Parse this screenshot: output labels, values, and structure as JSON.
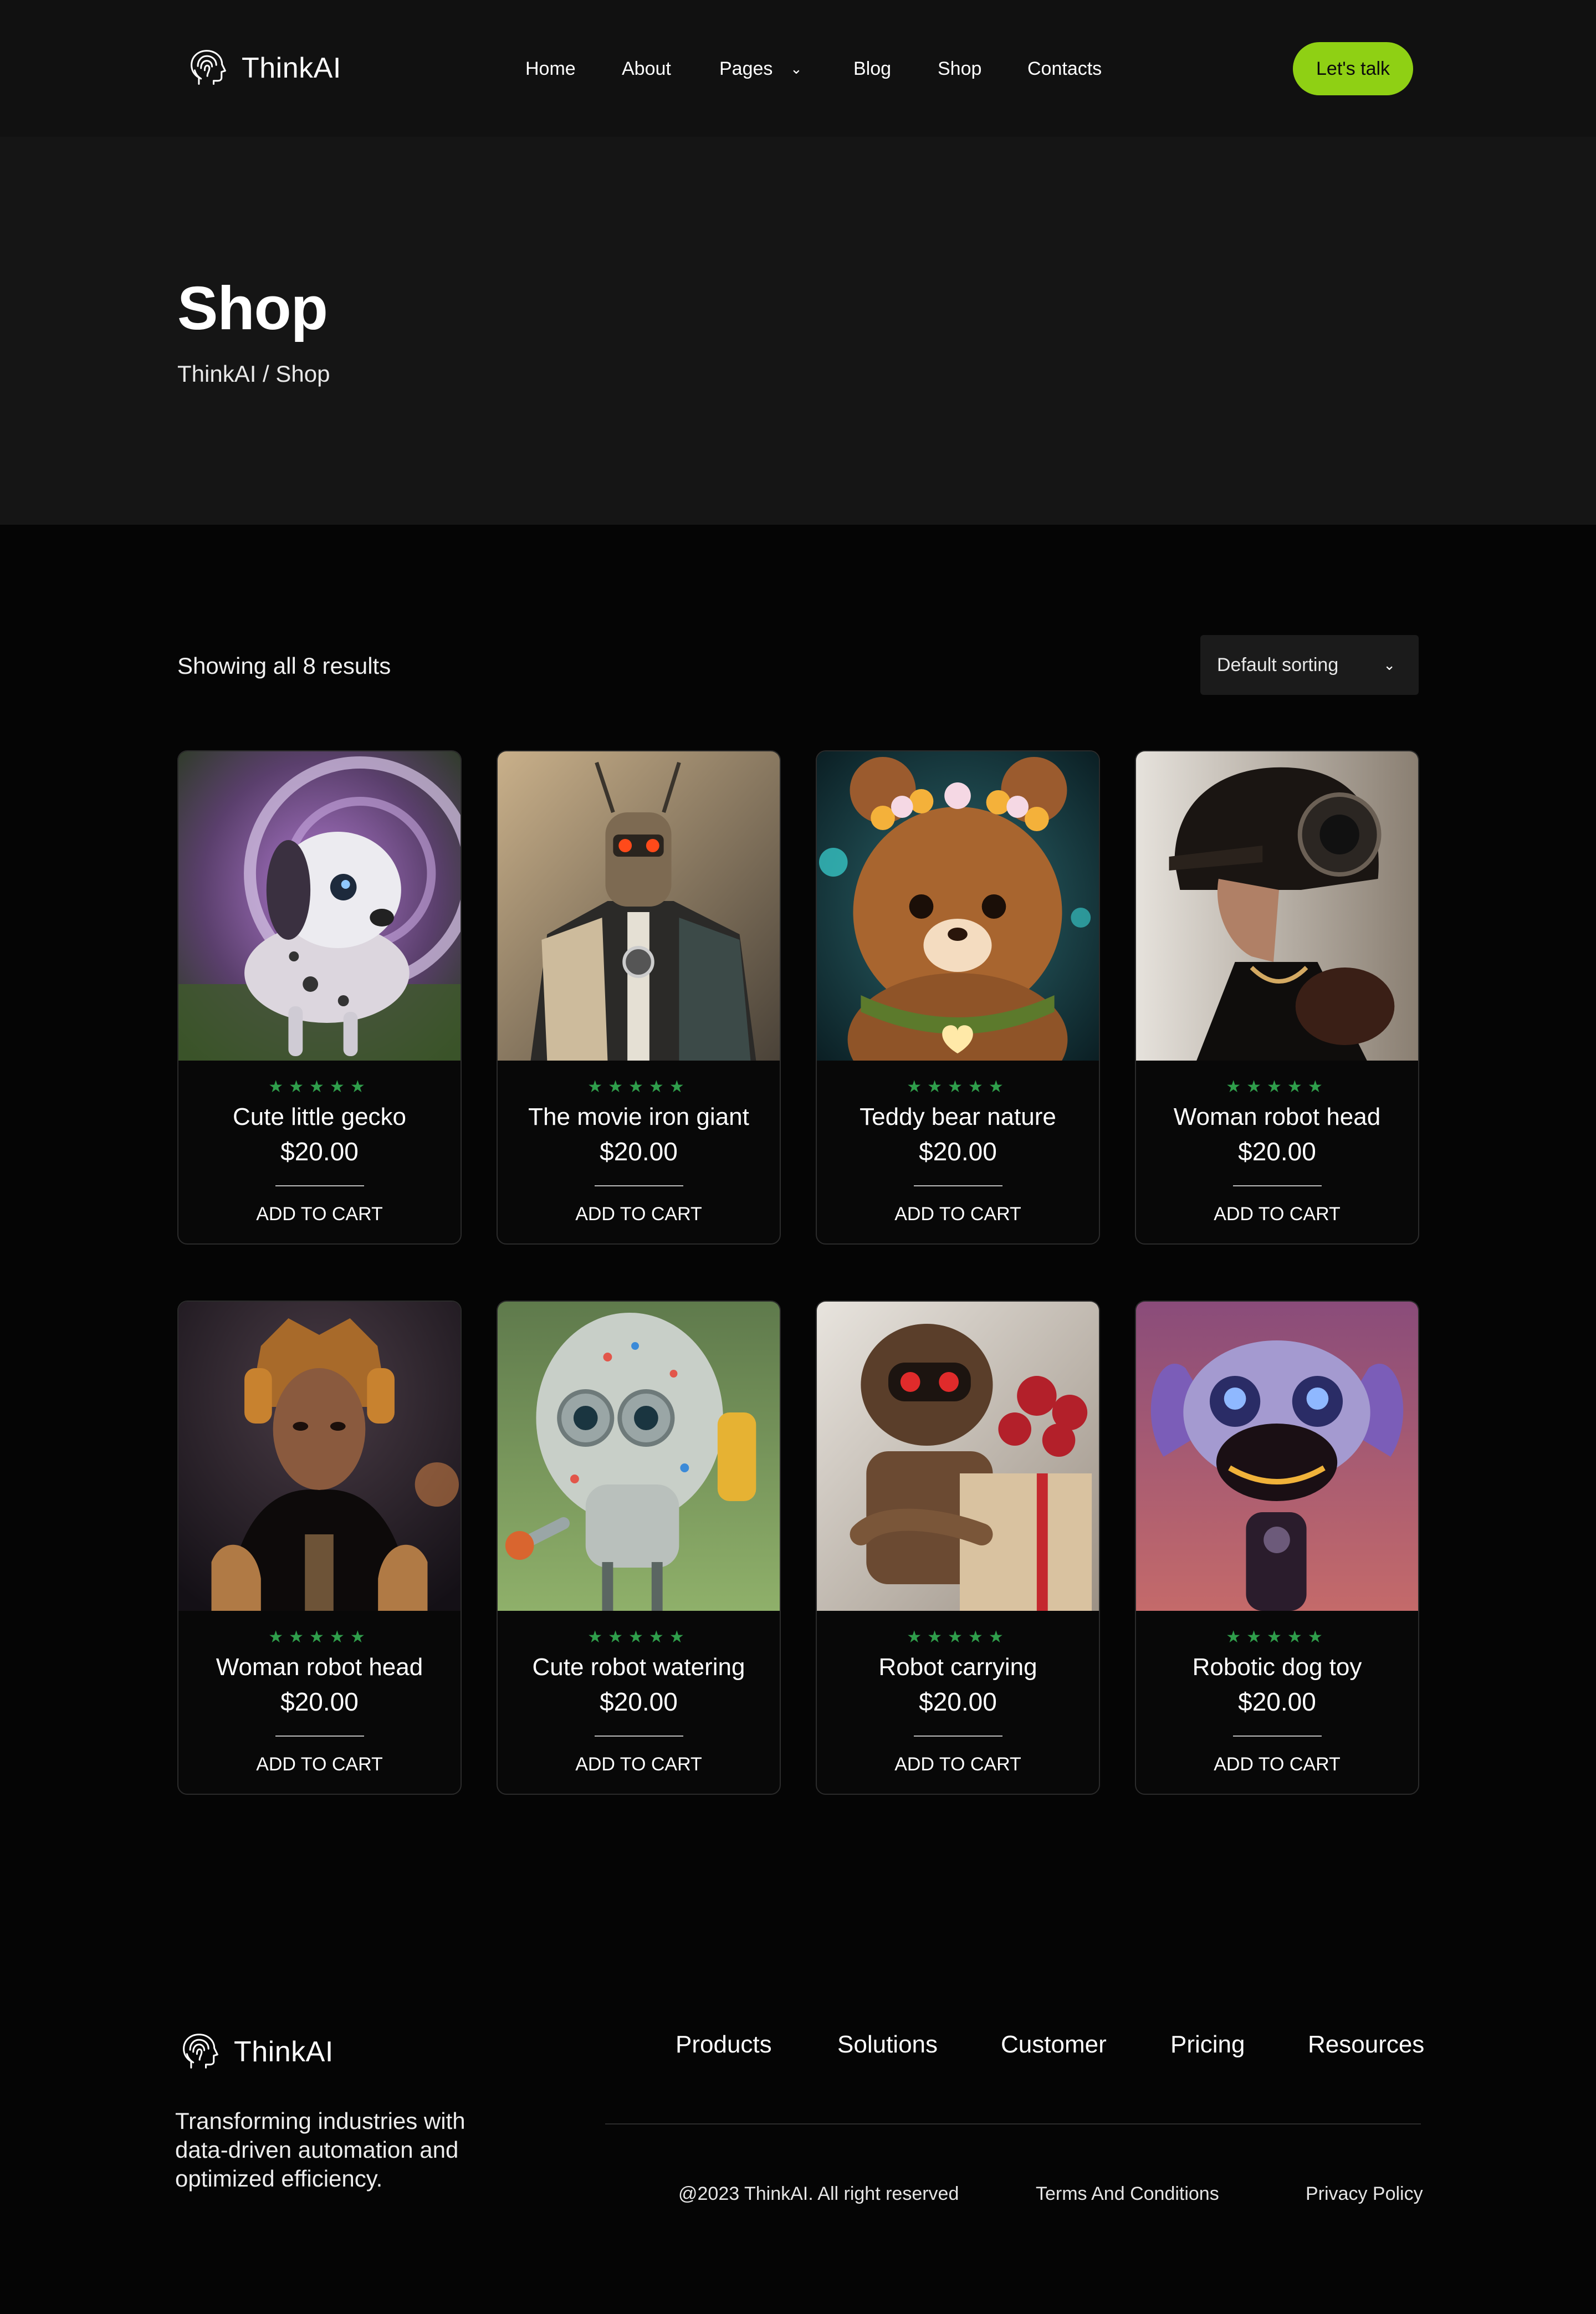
{
  "brand": {
    "name": "ThinkAI",
    "accent": "#8fd014",
    "star_color": "#2f9e4b"
  },
  "header": {
    "nav": [
      "Home",
      "About",
      "Pages",
      "Blog",
      "Shop",
      "Contacts"
    ],
    "cta_label": "Let's talk"
  },
  "hero": {
    "title": "Shop",
    "breadcrumb": "ThinkAI / Shop"
  },
  "toolbar": {
    "results_text": "Showing all 8 results",
    "sort_selected": "Default sorting"
  },
  "products": [
    {
      "name": "Cute little gecko",
      "price": "$20.00",
      "rating": "★★★★★",
      "cta": "ADD TO CART"
    },
    {
      "name": "The movie iron giant",
      "price": "$20.00",
      "rating": "★★★★★",
      "cta": "ADD TO CART"
    },
    {
      "name": "Teddy bear nature",
      "price": "$20.00",
      "rating": "★★★★★",
      "cta": "ADD TO CART"
    },
    {
      "name": "Woman robot head",
      "price": "$20.00",
      "rating": "★★★★★",
      "cta": "ADD TO CART"
    },
    {
      "name": "Woman robot head",
      "price": "$20.00",
      "rating": "★★★★★",
      "cta": "ADD TO CART"
    },
    {
      "name": "Cute robot watering",
      "price": "$20.00",
      "rating": "★★★★★",
      "cta": "ADD TO CART"
    },
    {
      "name": "Robot carrying",
      "price": "$20.00",
      "rating": "★★★★★",
      "cta": "ADD TO CART"
    },
    {
      "name": "Robotic dog toy",
      "price": "$20.00",
      "rating": "★★★★★",
      "cta": "ADD TO CART"
    }
  ],
  "footer": {
    "tagline": "Transforming industries with data-driven automation and optimized efficiency.",
    "links": [
      "Products",
      "Solutions",
      "Customer",
      "Pricing",
      "Resources"
    ],
    "copyright": "@2023 ThinkAI. All right reserved",
    "terms": "Terms And Conditions",
    "privacy": "Privacy Policy"
  }
}
